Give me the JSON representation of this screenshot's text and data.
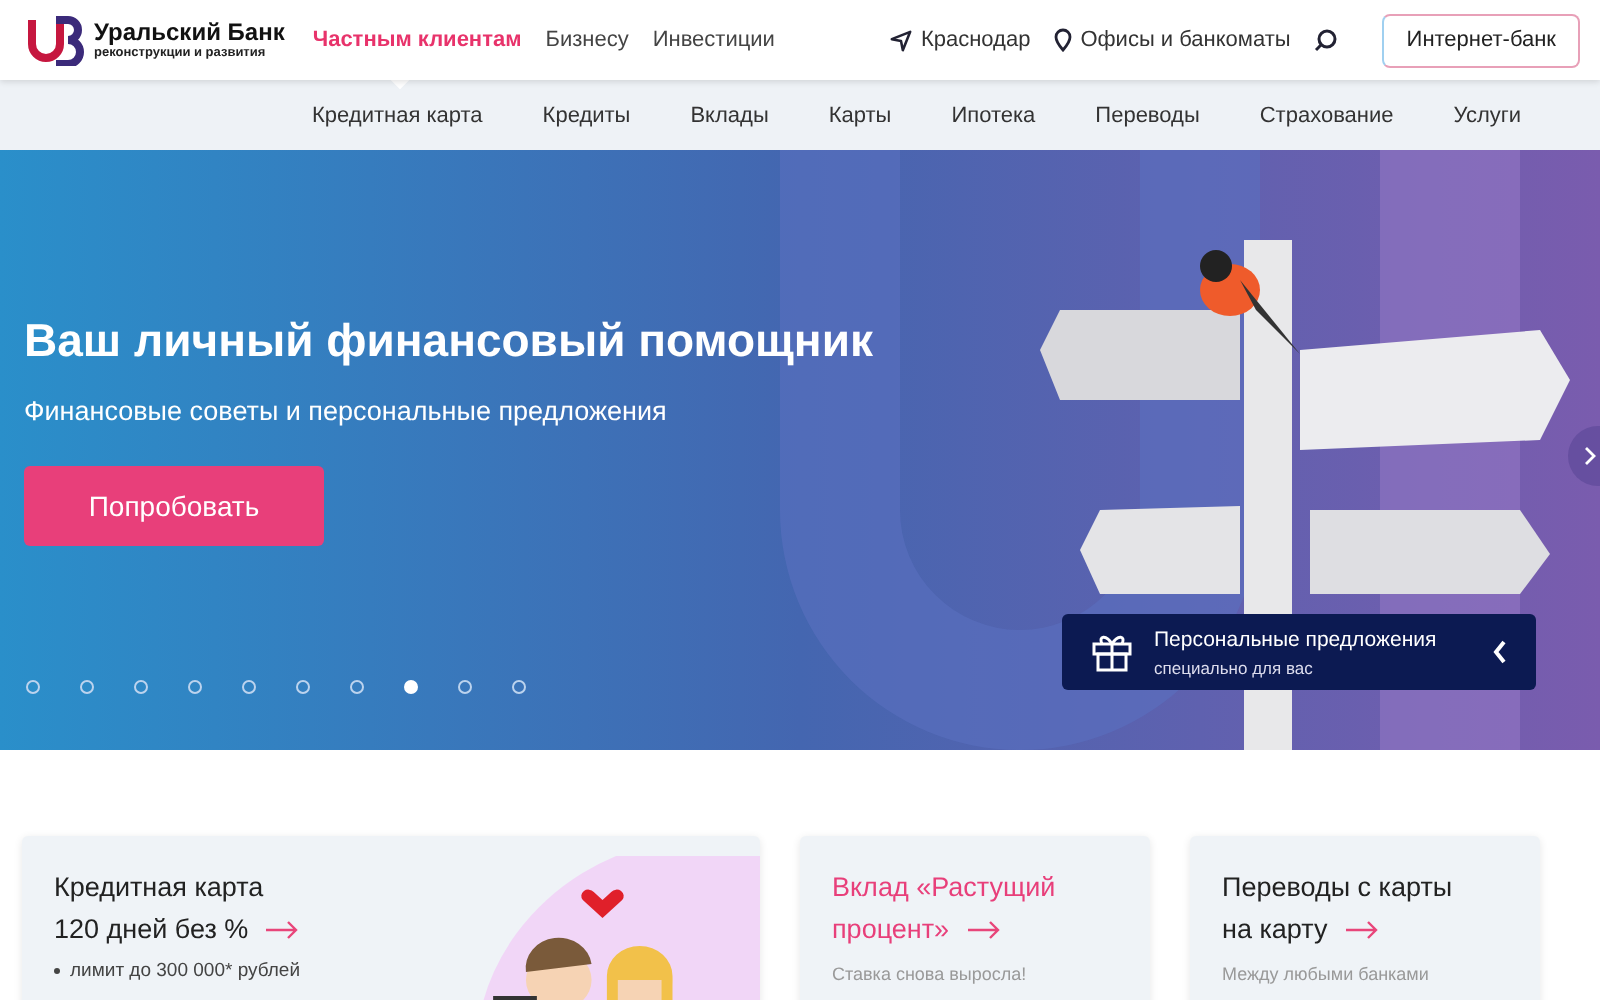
{
  "logo": {
    "name": "Уральский Банк",
    "tagline": "реконструкции и развития"
  },
  "top_nav": [
    {
      "label": "Частным клиентам",
      "selected": true
    },
    {
      "label": "Бизнесу",
      "selected": false
    },
    {
      "label": "Инвестиции",
      "selected": false
    }
  ],
  "city": "Краснодар",
  "offices": "Офисы и банкоматы",
  "internet_bank_button": "Интернет-банк",
  "sub_nav": [
    "Кредитная карта",
    "Кредиты",
    "Вклады",
    "Карты",
    "Ипотека",
    "Переводы",
    "Страхование",
    "Услуги"
  ],
  "hero": {
    "title": "Ваш личный финансовый помощник",
    "subtitle": "Финансовые советы и персональные предложения",
    "button": "Попробовать",
    "dots": [
      {
        "selected": false
      },
      {
        "selected": false
      },
      {
        "selected": false
      },
      {
        "selected": false
      },
      {
        "selected": false
      },
      {
        "selected": false
      },
      {
        "selected": false
      },
      {
        "selected": true
      },
      {
        "selected": false
      },
      {
        "selected": false
      }
    ],
    "offer": {
      "title": "Персональные предложения",
      "subtitle": "специально для вас"
    }
  },
  "cards": [
    {
      "title_lines": [
        "Кредитная карта",
        "120 дней без %"
      ],
      "accent": false,
      "bullet": "лимит до 300 000* рублей"
    },
    {
      "title_lines": [
        "Вклад «Растущий",
        "процент»"
      ],
      "accent": true,
      "note": "Ставка снова выросла!"
    },
    {
      "title_lines": [
        "Переводы с карты",
        "на карту"
      ],
      "accent": false,
      "note": "Между любыми банками"
    }
  ]
}
